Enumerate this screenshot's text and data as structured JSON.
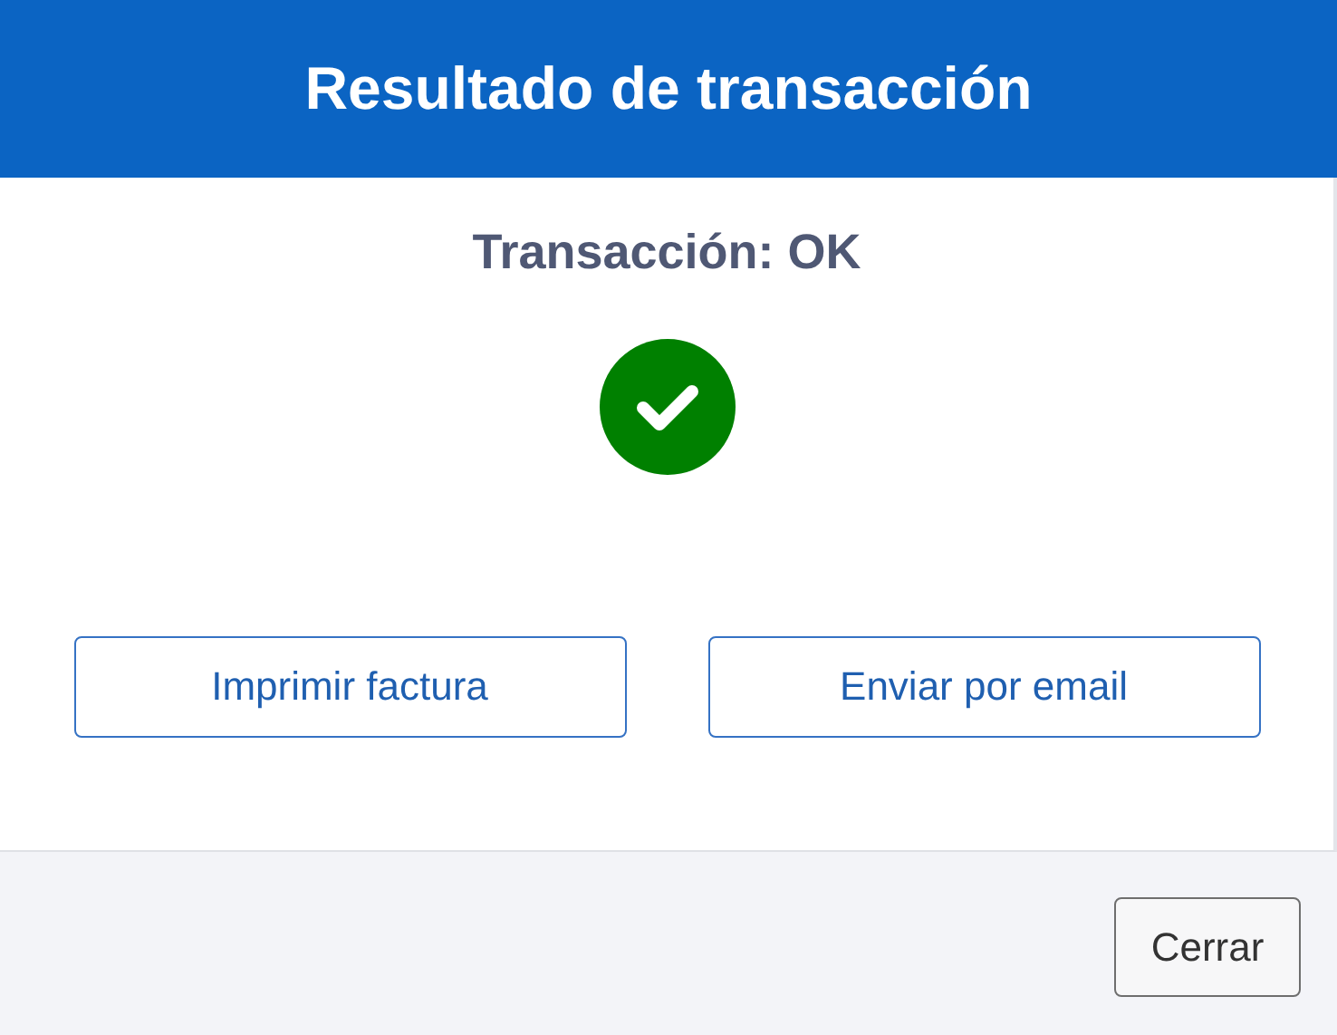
{
  "dialog": {
    "title": "Resultado de transacción"
  },
  "result": {
    "text": "Transacción: OK",
    "success": true
  },
  "actions": [
    {
      "label": "Imprimir factura"
    },
    {
      "label": "Enviar por email"
    }
  ],
  "footer_buttons": [
    {
      "label": "Cerrar"
    }
  ]
}
